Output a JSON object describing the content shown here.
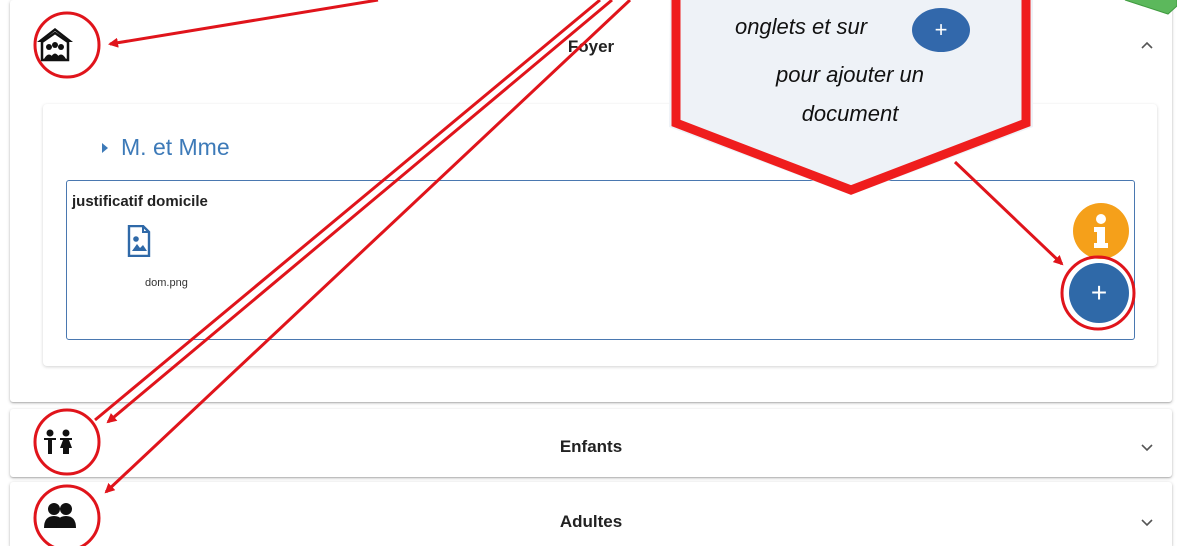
{
  "panels": {
    "foyer": {
      "title": "Foyer"
    },
    "enfants": {
      "title": "Enfants"
    },
    "adultes": {
      "title": "Adultes"
    }
  },
  "section": {
    "title": "M. et Mme"
  },
  "document": {
    "category": "justificatif domicile",
    "files": [
      {
        "name": "dom.png",
        "icon": "image-file-icon"
      }
    ]
  },
  "buttons": {
    "add_label": "+",
    "info_icon": "info-icon"
  },
  "callout": {
    "line1": "onglets et sur",
    "line2": "pour ajouter un",
    "line3": "document",
    "button_label": "+"
  },
  "colors": {
    "accent_blue": "#2f69a8",
    "info_orange": "#f5a01a",
    "annotation_red": "#e0141b",
    "callout_green": "#5cb85c"
  }
}
